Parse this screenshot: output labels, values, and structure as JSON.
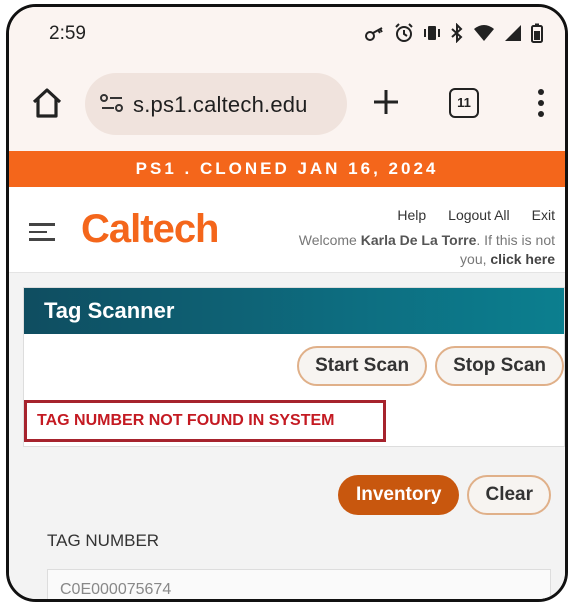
{
  "status_bar": {
    "time": "2:59",
    "icons": [
      "key-icon",
      "alarm-icon",
      "vibrate-icon",
      "bluetooth-icon",
      "wifi-icon",
      "signal-icon",
      "battery-icon"
    ]
  },
  "browser": {
    "url": "s.ps1.caltech.edu",
    "tab_count": "11"
  },
  "banner": {
    "text": "PS1 . CLONED JAN 16, 2024"
  },
  "header": {
    "logo": "Caltech",
    "links": {
      "help": "Help",
      "logout_all": "Logout All",
      "exit": "Exit"
    },
    "welcome_prefix": "Welcome ",
    "user_name": "Karla De La Torre",
    "welcome_suffix": ". If this is not you, ",
    "click_here": "click here"
  },
  "scanner": {
    "title": "Tag Scanner",
    "start_scan": "Start Scan",
    "stop_scan": "Stop Scan",
    "error_message": "TAG NUMBER NOT FOUND IN SYSTEM"
  },
  "actions": {
    "inventory": "Inventory",
    "clear": "Clear"
  },
  "tag_field": {
    "label": "TAG NUMBER",
    "value": "C0E000075674"
  },
  "colors": {
    "brand_orange": "#f4661b",
    "header_teal": "#0f4d60",
    "error_red": "#c41a22",
    "inventory_button": "#c8570e"
  }
}
